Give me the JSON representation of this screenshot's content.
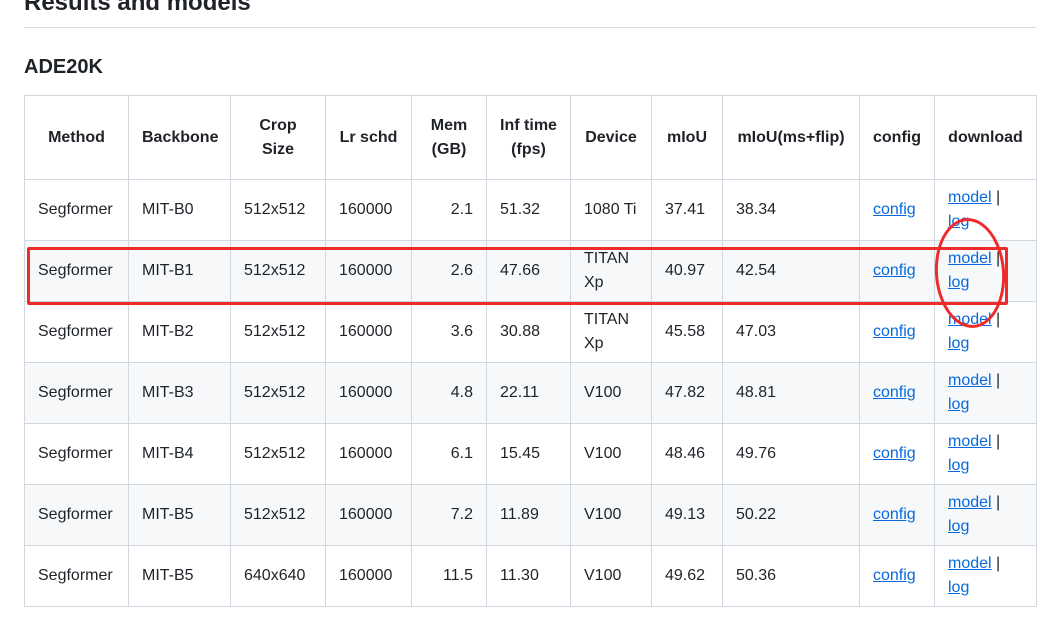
{
  "page": {
    "section_title": "Results and models",
    "dataset_title": "ADE20K"
  },
  "table": {
    "headers": [
      {
        "key": "method",
        "label": "Method"
      },
      {
        "key": "backbone",
        "label": "Backbone"
      },
      {
        "key": "crop_size",
        "label": "Crop Size"
      },
      {
        "key": "lr_schd",
        "label": "Lr schd"
      },
      {
        "key": "mem",
        "label": "Mem (GB)"
      },
      {
        "key": "inf_time",
        "label": "Inf time (fps)"
      },
      {
        "key": "device",
        "label": "Device"
      },
      {
        "key": "miou",
        "label": "mIoU"
      },
      {
        "key": "miou_ms",
        "label": "mIoU(ms+flip)"
      },
      {
        "key": "config",
        "label": "config"
      },
      {
        "key": "download",
        "label": "download"
      }
    ],
    "rows": [
      {
        "method": "Segformer",
        "backbone": "MIT-B0",
        "crop_size": "512x512",
        "lr_schd": "160000",
        "mem": "2.1",
        "inf_time": "51.32",
        "device": "1080 Ti",
        "miou": "37.41",
        "miou_ms": "38.34",
        "config": "config",
        "model": "model",
        "sep": "|",
        "log": "log"
      },
      {
        "method": "Segformer",
        "backbone": "MIT-B1",
        "crop_size": "512x512",
        "lr_schd": "160000",
        "mem": "2.6",
        "inf_time": "47.66",
        "device": "TITAN Xp",
        "miou": "40.97",
        "miou_ms": "42.54",
        "config": "config",
        "model": "model",
        "sep": "|",
        "log": "log"
      },
      {
        "method": "Segformer",
        "backbone": "MIT-B2",
        "crop_size": "512x512",
        "lr_schd": "160000",
        "mem": "3.6",
        "inf_time": "30.88",
        "device": "TITAN Xp",
        "miou": "45.58",
        "miou_ms": "47.03",
        "config": "config",
        "model": "model",
        "sep": "|",
        "log": "log"
      },
      {
        "method": "Segformer",
        "backbone": "MIT-B3",
        "crop_size": "512x512",
        "lr_schd": "160000",
        "mem": "4.8",
        "inf_time": "22.11",
        "device": "V100",
        "miou": "47.82",
        "miou_ms": "48.81",
        "config": "config",
        "model": "model",
        "sep": "|",
        "log": "log"
      },
      {
        "method": "Segformer",
        "backbone": "MIT-B4",
        "crop_size": "512x512",
        "lr_schd": "160000",
        "mem": "6.1",
        "inf_time": "15.45",
        "device": "V100",
        "miou": "48.46",
        "miou_ms": "49.76",
        "config": "config",
        "model": "model",
        "sep": "|",
        "log": "log"
      },
      {
        "method": "Segformer",
        "backbone": "MIT-B5",
        "crop_size": "512x512",
        "lr_schd": "160000",
        "mem": "7.2",
        "inf_time": "11.89",
        "device": "V100",
        "miou": "49.13",
        "miou_ms": "50.22",
        "config": "config",
        "model": "model",
        "sep": "|",
        "log": "log"
      },
      {
        "method": "Segformer",
        "backbone": "MIT-B5",
        "crop_size": "640x640",
        "lr_schd": "160000",
        "mem": "11.5",
        "inf_time": "11.30",
        "device": "V100",
        "miou": "49.62",
        "miou_ms": "50.36",
        "config": "config",
        "model": "model",
        "sep": "|",
        "log": "log"
      }
    ]
  },
  "annotations": {
    "highlight_color": "#ee2b2b",
    "link_color": "#0969da"
  }
}
